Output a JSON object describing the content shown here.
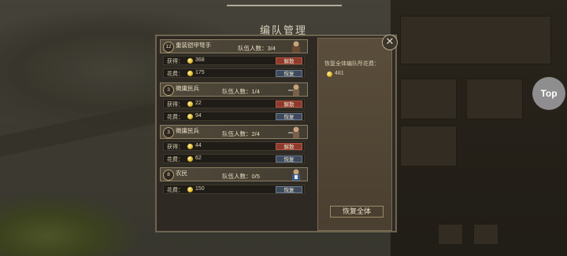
{
  "title": "编队管理",
  "top_button": "Top",
  "close_icon": "close-icon",
  "right_panel": {
    "label": "恢复全体编队所花费：",
    "cost": "481",
    "restore_all": "恢复全体"
  },
  "troops": [
    {
      "level": "12",
      "name": "重装铠甲弩手",
      "count": "队伍人数：3/4",
      "rows": [
        {
          "label": "获得：",
          "value": "368",
          "button": "解散",
          "style": "red"
        },
        {
          "label": "花费：",
          "value": "175",
          "button": "恢复",
          "style": "blue"
        }
      ]
    },
    {
      "level": "3",
      "name": "徵庸民兵",
      "count": "队伍人数：1/4",
      "rows": [
        {
          "label": "获得：",
          "value": "22",
          "button": "解散",
          "style": "red"
        },
        {
          "label": "花费：",
          "value": "94",
          "button": "恢复",
          "style": "blue"
        }
      ]
    },
    {
      "level": "3",
      "name": "徵庸民兵",
      "count": "队伍人数：2/4",
      "rows": [
        {
          "label": "获得：",
          "value": "44",
          "button": "解散",
          "style": "red"
        },
        {
          "label": "花费：",
          "value": "62",
          "button": "恢复",
          "style": "blue"
        }
      ]
    },
    {
      "level": "8",
      "name": "农民",
      "count": "队伍人数：0/5",
      "rows": [
        {
          "label": "花费：",
          "value": "150",
          "button": "恢复",
          "style": "blue"
        }
      ]
    }
  ]
}
